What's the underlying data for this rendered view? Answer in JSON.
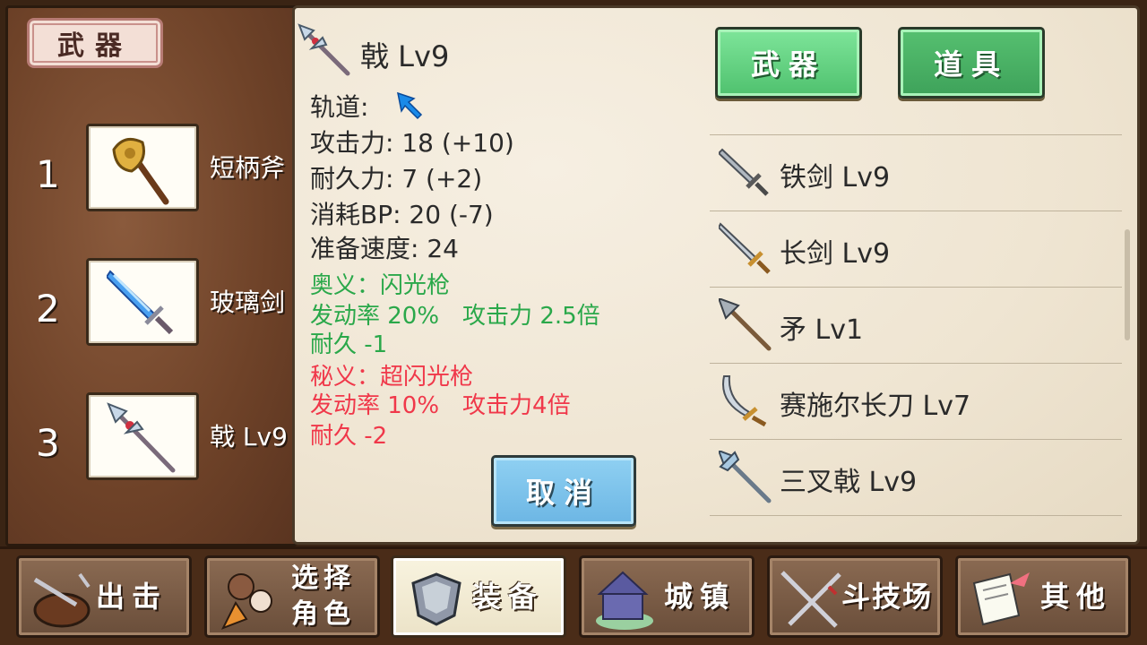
{
  "left": {
    "section_tag": "武器",
    "slots": [
      {
        "number": "1",
        "name": "短柄斧",
        "icon": "axe-icon"
      },
      {
        "number": "2",
        "name": "玻璃剑",
        "icon": "glass-sword-icon"
      },
      {
        "number": "3",
        "name": "戟 Lv9",
        "icon": "halberd-icon"
      }
    ]
  },
  "detail": {
    "title": "戟 Lv9",
    "orbit_label": "轨道:",
    "attack": "攻击力: 18 (+10)",
    "durability": "耐久力: 7 (+2)",
    "bp_cost": "消耗BP: 20 (-7)",
    "prep_speed": "准备速度: 24",
    "secret_green": {
      "name": "奥义：闪光枪",
      "line2": "发动率 20%　攻击力 2.5倍",
      "line3": "耐久 -1"
    },
    "secret_red": {
      "name": "秘义：超闪光枪",
      "line2": "发动率 10%　攻击力4倍",
      "line3": "耐久 -2"
    },
    "cancel_label": "取消",
    "colors": {
      "green": "#2aa84a",
      "red": "#f0384a"
    }
  },
  "tabs": {
    "weapons": "武器",
    "items": "道具"
  },
  "list": [
    {
      "label": "铁剑 Lv9",
      "icon": "iron-sword-icon"
    },
    {
      "label": "长剑 Lv9",
      "icon": "long-sword-icon"
    },
    {
      "label": "矛 Lv1",
      "icon": "spear-icon"
    },
    {
      "label": "赛施尔长刀 Lv7",
      "icon": "scimitar-icon"
    },
    {
      "label": "三叉戟 Lv9",
      "icon": "trident-icon"
    }
  ],
  "nav": [
    {
      "label": "出击",
      "icon": "sortie-icon"
    },
    {
      "label": "选择\n角色",
      "icon": "character-icon"
    },
    {
      "label": "装备",
      "icon": "armor-icon"
    },
    {
      "label": "城镇",
      "icon": "town-icon"
    },
    {
      "label": "斗技场",
      "icon": "arena-icon"
    },
    {
      "label": "其他",
      "icon": "scroll-icon"
    }
  ]
}
